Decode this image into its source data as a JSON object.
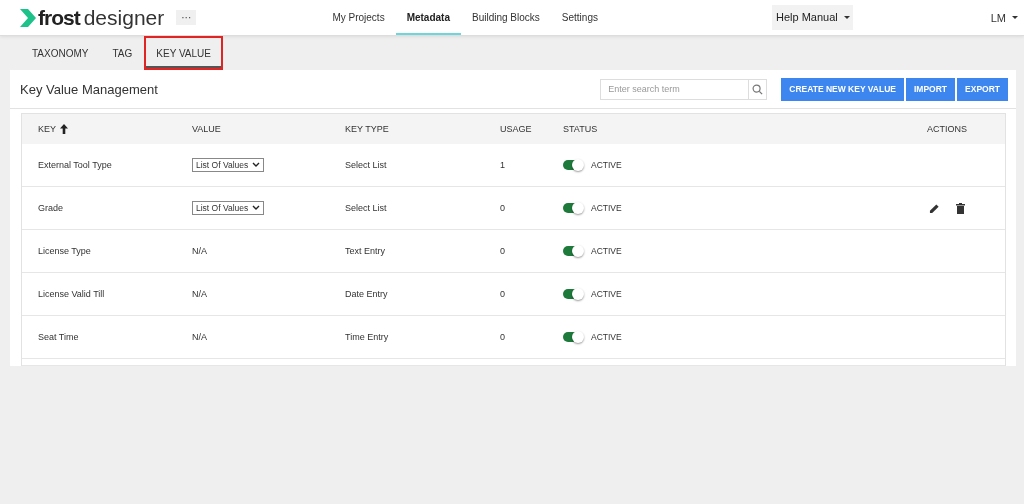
{
  "header": {
    "logo_word_1": "frost",
    "logo_word_2": "designer",
    "more_button": "···",
    "nav": [
      {
        "label": "My Projects",
        "selected": false
      },
      {
        "label": "Metadata",
        "selected": true
      },
      {
        "label": "Building Blocks",
        "selected": false
      },
      {
        "label": "Settings",
        "selected": false
      }
    ],
    "help_menu": "Help Manual",
    "user_menu": "LM"
  },
  "tabs": [
    {
      "label": "TAXONOMY",
      "selected": false,
      "highlighted": false
    },
    {
      "label": "TAG",
      "selected": false,
      "highlighted": false
    },
    {
      "label": "KEY VALUE",
      "selected": true,
      "highlighted": true
    }
  ],
  "panel": {
    "title": "Key Value Management",
    "search": {
      "placeholder": "Enter search term"
    },
    "buttons": [
      "CREATE NEW KEY VALUE",
      "IMPORT",
      "EXPORT"
    ]
  },
  "table": {
    "columns": [
      "KEY",
      "VALUE",
      "KEY TYPE",
      "USAGE",
      "STATUS",
      "ACTIONS"
    ],
    "rows": [
      {
        "key": "External Tool Type",
        "value": {
          "kind": "select",
          "text": "List Of Values"
        },
        "key_type": "Select List",
        "usage": "1",
        "active": true,
        "status": "ACTIVE",
        "actions_visible": false
      },
      {
        "key": "Grade",
        "value": {
          "kind": "select",
          "text": "List Of Values"
        },
        "key_type": "Select List",
        "usage": "0",
        "active": true,
        "status": "ACTIVE",
        "actions_visible": true
      },
      {
        "key": "License Type",
        "value": {
          "kind": "text",
          "text": "N/A"
        },
        "key_type": "Text Entry",
        "usage": "0",
        "active": true,
        "status": "ACTIVE",
        "actions_visible": false
      },
      {
        "key": "License Valid Till",
        "value": {
          "kind": "text",
          "text": "N/A"
        },
        "key_type": "Date Entry",
        "usage": "0",
        "active": true,
        "status": "ACTIVE",
        "actions_visible": false
      },
      {
        "key": "Seat Time",
        "value": {
          "kind": "text",
          "text": "N/A"
        },
        "key_type": "Time Entry",
        "usage": "0",
        "active": true,
        "status": "ACTIVE",
        "actions_visible": false
      }
    ]
  }
}
